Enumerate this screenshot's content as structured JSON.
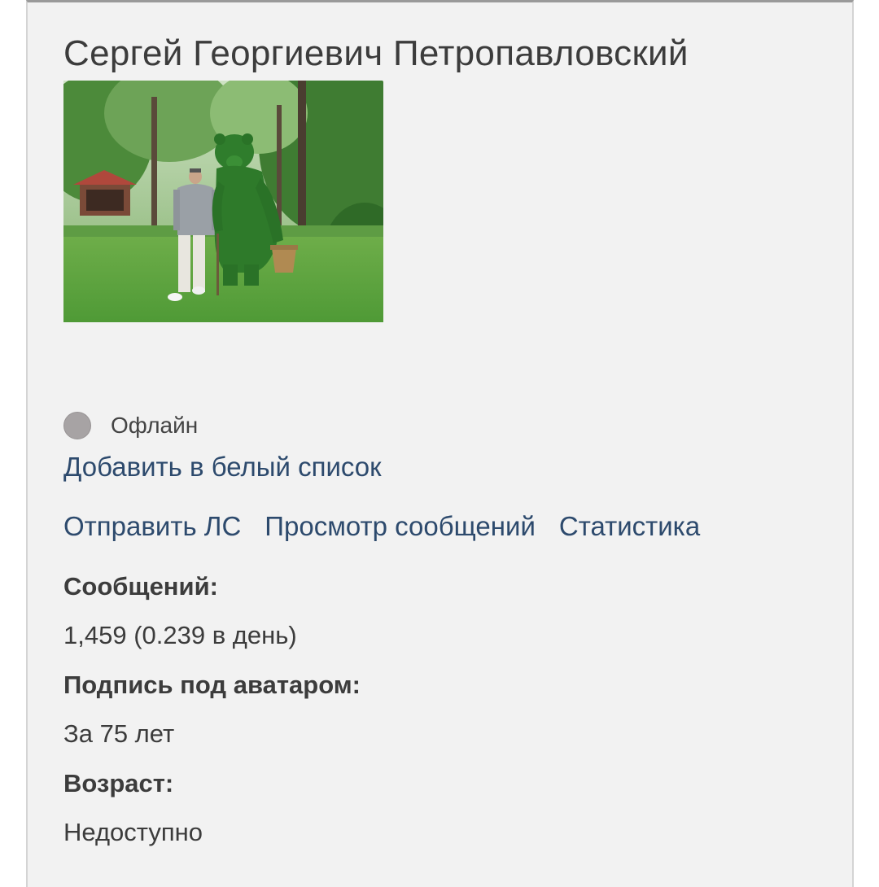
{
  "profile": {
    "name": "Сергей Георгиевич Петропавловский",
    "status": "Офлайн",
    "whitelist_link": "Добавить в белый список",
    "actions": {
      "send_pm": "Отправить ЛС",
      "view_posts": "Просмотр сообщений",
      "statistics": "Статистика"
    },
    "fields": {
      "posts_label": "Сообщений:",
      "posts_value": "1,459 (0.239 в день)",
      "signature_label": "Подпись под аватаром:",
      "signature_value": "За 75 лет",
      "age_label": "Возраст:",
      "age_value": "Недоступно"
    }
  },
  "colors": {
    "link": "#2d4a6d",
    "text": "#3c3c3c",
    "card_bg": "#f2f2f2",
    "status_offline": "#a7a3a4"
  },
  "avatar": {
    "icon": "avatar-photo-man-with-topiary-bear"
  }
}
